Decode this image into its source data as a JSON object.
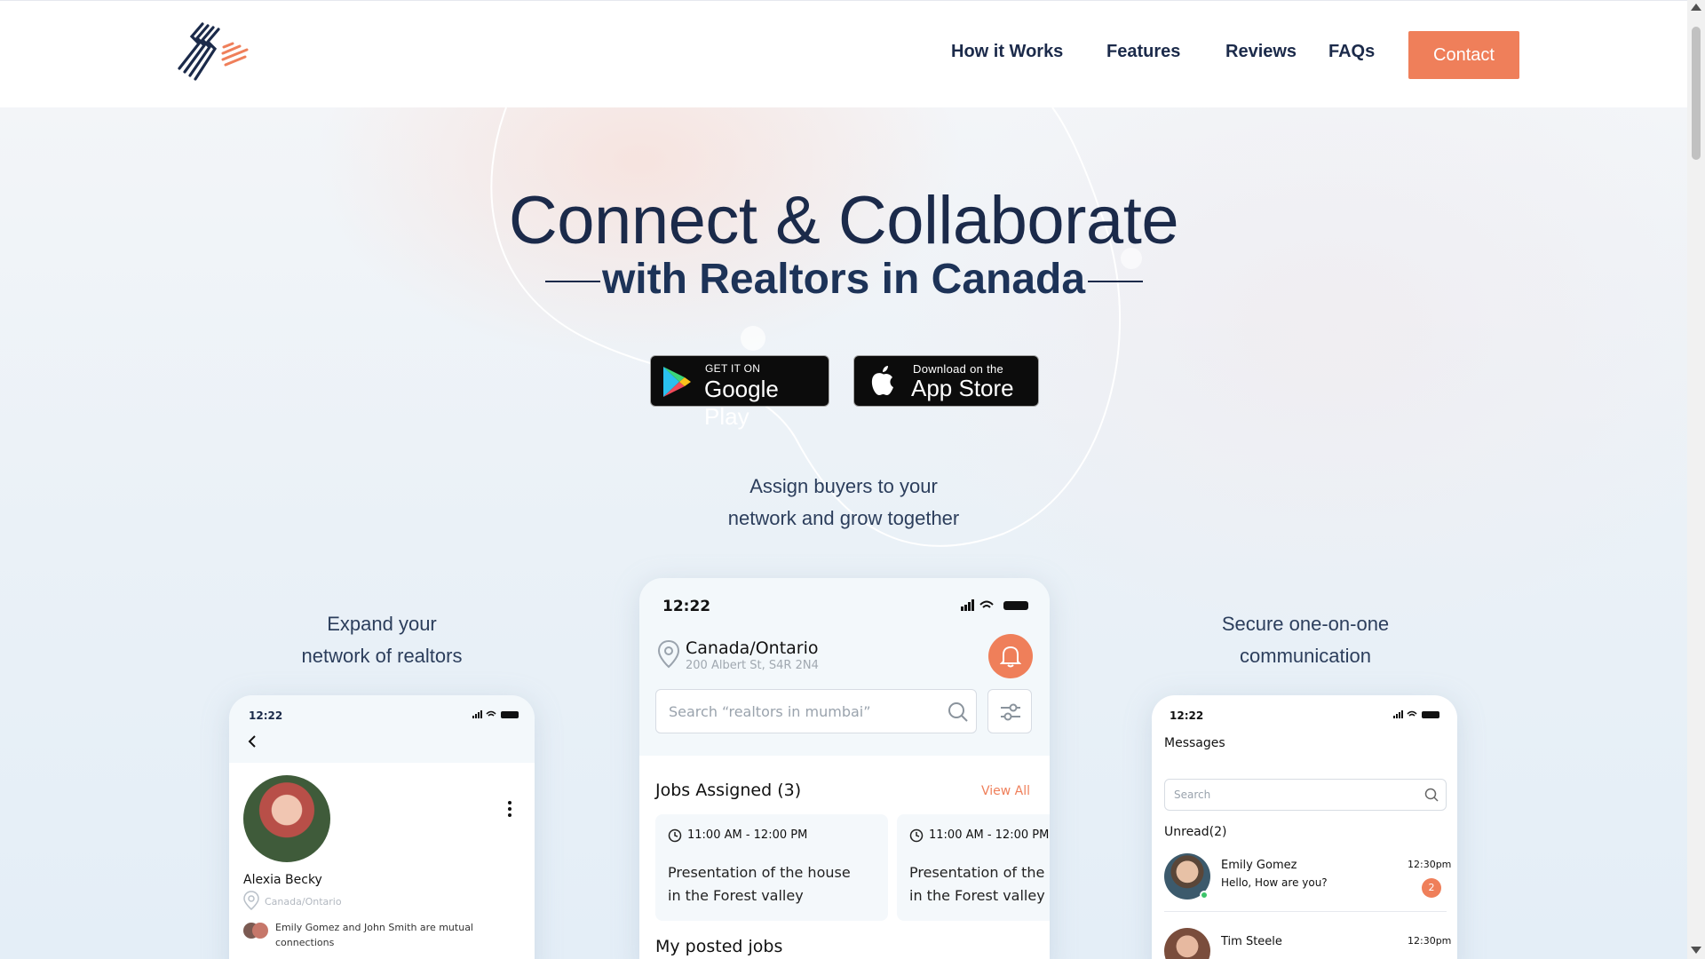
{
  "colors": {
    "accent": "#ef7f5a",
    "navy": "#1b2a4a",
    "badge": "#ef7f5a"
  },
  "header": {
    "logo_icon": "stripes-logo-icon",
    "nav": [
      {
        "label": "How it Works"
      },
      {
        "label": "Features"
      },
      {
        "label": "Reviews"
      },
      {
        "label": "FAQs"
      }
    ],
    "contact_label": "Contact"
  },
  "hero": {
    "title": "Connect & Collaborate",
    "subtitle": "with Realtors in Canada",
    "google_play": {
      "small": "GET IT ON",
      "big": "Google Play"
    },
    "app_store": {
      "small": "Download on the",
      "big": "App Store"
    },
    "center_caption": {
      "line1": "Assign buyers to your",
      "line2": "network and grow together"
    },
    "left_caption": {
      "line1": "Expand your",
      "line2": "network of realtors"
    },
    "right_caption": {
      "line1": "Secure one-on-one",
      "line2": "communication"
    }
  },
  "left_phone": {
    "time": "12:22",
    "name": "Alexia Becky",
    "location": "Canada/Ontario",
    "mutual": "Emily Gomez and John Smith are mutual",
    "mutual2": "connections"
  },
  "center_phone": {
    "time": "12:22",
    "region": "Canada/Ontario",
    "address": "200 Albert St, S4R 2N4",
    "search_placeholder": "Search “realtors in mumbai”",
    "jobs_title": "Jobs Assigned (3)",
    "view_all": "View All",
    "jobs": [
      {
        "time": "11:00 AM - 12:00 PM",
        "line1": "Presentation of the house",
        "line2": "in the Forest valley"
      },
      {
        "time": "11:00 AM - 12:00 PM",
        "line1": "Presentation of the house",
        "line2": "in the Forest valley"
      }
    ],
    "posted_title": "My posted jobs"
  },
  "right_phone": {
    "time": "12:22",
    "title": "Messages",
    "search_placeholder": "Search",
    "unread": "Unread(2)",
    "messages": [
      {
        "name": "Emily Gomez",
        "preview": "Hello, How are you?",
        "time": "12:30pm",
        "badge": "2"
      },
      {
        "name": "Tim Steele",
        "time": "12:30pm"
      }
    ]
  }
}
